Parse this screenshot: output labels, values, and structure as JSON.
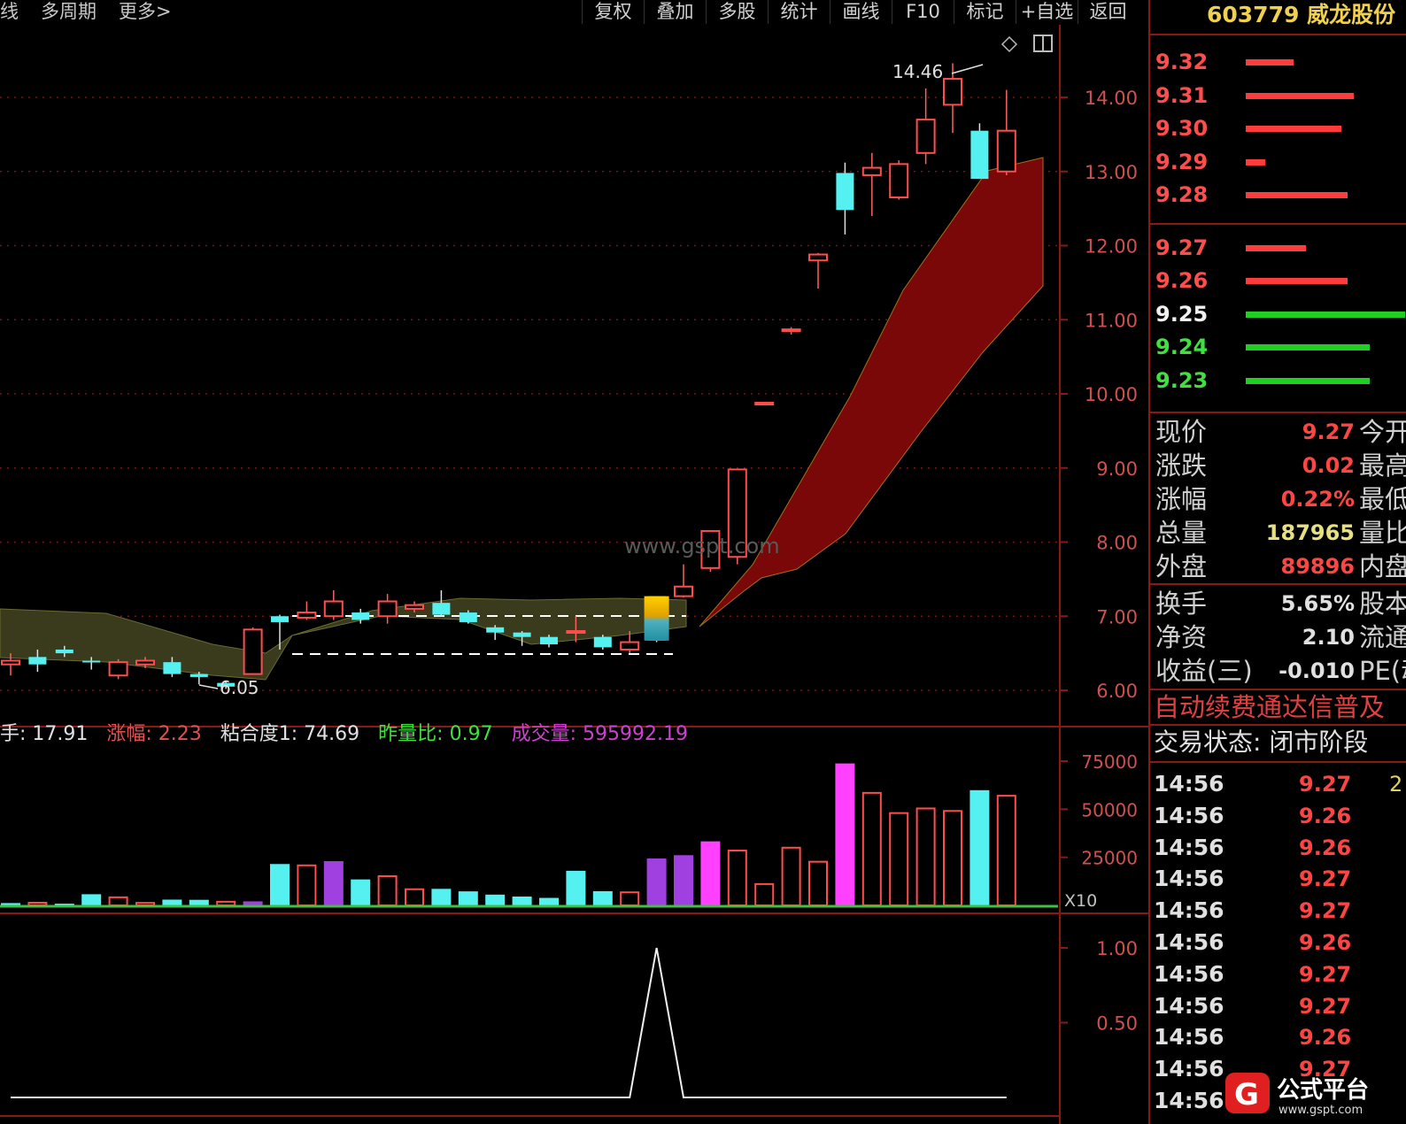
{
  "toolbar": {
    "left_items": [
      "线",
      "多周期",
      "更多>"
    ],
    "buttons": [
      "复权",
      "叠加",
      "多股",
      "统计",
      "画线",
      "F10",
      "标记",
      "+自选",
      "返回"
    ]
  },
  "stock": {
    "code": "603779",
    "name": "威龙股份"
  },
  "orderbook": [
    {
      "price": "9.32",
      "side": "ask",
      "size": 0.3
    },
    {
      "price": "9.31",
      "side": "ask",
      "size": 0.68
    },
    {
      "price": "9.30",
      "side": "ask",
      "size": 0.6
    },
    {
      "price": "9.29",
      "side": "ask",
      "size": 0.12
    },
    {
      "price": "9.28",
      "side": "ask",
      "size": 0.64
    },
    {
      "price": "9.27",
      "side": "bid",
      "size": 0.38
    },
    {
      "price": "9.26",
      "side": "bid",
      "size": 0.64
    },
    {
      "price": "9.25",
      "side": "bid",
      "size": 1.0
    },
    {
      "price": "9.24",
      "side": "bid",
      "size": 0.78
    },
    {
      "price": "9.23",
      "side": "bid",
      "size": 0.78
    }
  ],
  "quotes": [
    {
      "label": "现价",
      "value": "9.27",
      "label2": "今开",
      "color": "#ff4444"
    },
    {
      "label": "涨跌",
      "value": "0.02",
      "label2": "最高",
      "color": "#ff4444"
    },
    {
      "label": "涨幅",
      "value": "0.22%",
      "label2": "最低",
      "color": "#ff4444"
    },
    {
      "label": "总量",
      "value": "187965",
      "label2": "量比",
      "color": "#e8e080"
    },
    {
      "label": "外盘",
      "value": "89896",
      "label2": "内盘",
      "color": "#ff4444"
    },
    {
      "label": "换手",
      "value": "5.65%",
      "label2": "股本",
      "color": "#e0e0e0"
    },
    {
      "label": "净资",
      "value": "2.10",
      "label2": "流通",
      "color": "#e0e0e0"
    },
    {
      "label": "收益(三)",
      "value": "-0.010",
      "label2": "PE(动)",
      "color": "#e0e0e0"
    }
  ],
  "marquee": "自动续费通达信普及",
  "trade_status": "交易状态: 闭市阶段",
  "ticks": [
    {
      "time": "14:56",
      "price": "9.27",
      "extra": "2"
    },
    {
      "time": "14:56",
      "price": "9.26",
      "extra": ""
    },
    {
      "time": "14:56",
      "price": "9.26",
      "extra": ""
    },
    {
      "time": "14:56",
      "price": "9.27",
      "extra": ""
    },
    {
      "time": "14:56",
      "price": "9.27",
      "extra": ""
    },
    {
      "time": "14:56",
      "price": "9.26",
      "extra": ""
    },
    {
      "time": "14:56",
      "price": "9.27",
      "extra": ""
    },
    {
      "time": "14:56",
      "price": "9.27",
      "extra": ""
    },
    {
      "time": "14:56",
      "price": "9.26",
      "extra": ""
    },
    {
      "time": "14:56",
      "price": "9.27",
      "extra": ""
    },
    {
      "time": "14:56",
      "price": "",
      "extra": ""
    }
  ],
  "indicators": [
    {
      "text": "手: 17.91",
      "color": "#e0e0e0"
    },
    {
      "text": "涨幅: 2.23",
      "color": "#e05050"
    },
    {
      "text": "粘合度1: 74.69",
      "color": "#e0e0e0"
    },
    {
      "text": "昨量比: 0.97",
      "color": "#40e040"
    },
    {
      "text": "成交量: 595992.19",
      "color": "#d040d0"
    }
  ],
  "price_axis": [
    "14.00",
    "13.00",
    "12.00",
    "11.00",
    "10.00",
    "9.00",
    "8.00",
    "7.00",
    "6.00"
  ],
  "volume_axis": [
    "75000",
    "50000",
    "25000"
  ],
  "volume_unit": "X10",
  "osc_axis": [
    "1.00",
    "0.50"
  ],
  "annotations": {
    "high": "14.46",
    "low": "6.05"
  },
  "watermark": "www.gspt.com",
  "logo": {
    "name": "公式平台",
    "url": "www.gspt.com"
  },
  "chart_data": {
    "type": "candlestick",
    "candles": [
      {
        "o": 6.35,
        "c": 6.4,
        "h": 6.5,
        "l": 6.2
      },
      {
        "o": 6.45,
        "c": 6.35,
        "h": 6.55,
        "l": 6.25
      },
      {
        "o": 6.55,
        "c": 6.5,
        "h": 6.6,
        "l": 6.45
      },
      {
        "o": 6.4,
        "c": 6.38,
        "h": 6.45,
        "l": 6.28
      },
      {
        "o": 6.2,
        "c": 6.38,
        "h": 6.42,
        "l": 6.15
      },
      {
        "o": 6.35,
        "c": 6.4,
        "h": 6.45,
        "l": 6.3
      },
      {
        "o": 6.38,
        "c": 6.22,
        "h": 6.45,
        "l": 6.18
      },
      {
        "o": 6.22,
        "c": 6.18,
        "h": 6.25,
        "l": 6.08
      },
      {
        "o": 6.1,
        "c": 6.05,
        "h": 6.12,
        "l": 6.02
      },
      {
        "o": 6.22,
        "c": 6.82,
        "h": 6.85,
        "l": 6.22
      },
      {
        "o": 7.0,
        "c": 6.92,
        "h": 7.02,
        "l": 6.55
      },
      {
        "o": 6.98,
        "c": 7.05,
        "h": 7.2,
        "l": 6.95
      },
      {
        "o": 7.0,
        "c": 7.2,
        "h": 7.35,
        "l": 6.95
      },
      {
        "o": 7.05,
        "c": 6.95,
        "h": 7.1,
        "l": 6.9
      },
      {
        "o": 7.0,
        "c": 7.2,
        "h": 7.3,
        "l": 6.9
      },
      {
        "o": 7.1,
        "c": 7.15,
        "h": 7.2,
        "l": 7.05
      },
      {
        "o": 7.18,
        "c": 7.02,
        "h": 7.35,
        "l": 7.0
      },
      {
        "o": 7.05,
        "c": 6.92,
        "h": 7.08,
        "l": 6.9
      },
      {
        "o": 6.85,
        "c": 6.78,
        "h": 6.88,
        "l": 6.68
      },
      {
        "o": 6.78,
        "c": 6.72,
        "h": 6.8,
        "l": 6.6
      },
      {
        "o": 6.72,
        "c": 6.62,
        "h": 6.75,
        "l": 6.58
      },
      {
        "o": 6.8,
        "c": 6.8,
        "h": 7.0,
        "l": 6.65
      },
      {
        "o": 6.72,
        "c": 6.58,
        "h": 6.75,
        "l": 6.55
      },
      {
        "o": 6.55,
        "c": 6.65,
        "h": 6.8,
        "l": 6.5
      },
      {
        "o": 7.27,
        "c": 6.67,
        "h": 7.27,
        "l": 6.65
      },
      {
        "o": 7.27,
        "c": 7.4,
        "h": 7.7,
        "l": 7.25
      },
      {
        "o": 7.65,
        "c": 8.15,
        "h": 8.15,
        "l": 7.6
      },
      {
        "o": 7.8,
        "c": 8.98,
        "h": 8.98,
        "l": 7.7
      },
      {
        "o": 9.88,
        "c": 9.88,
        "h": 9.88,
        "l": 9.88
      },
      {
        "o": 10.87,
        "c": 10.87,
        "h": 10.9,
        "l": 10.8
      },
      {
        "o": 11.8,
        "c": 11.88,
        "h": 11.9,
        "l": 11.42
      },
      {
        "o": 12.98,
        "c": 12.48,
        "h": 13.12,
        "l": 12.15
      },
      {
        "o": 12.95,
        "c": 13.05,
        "h": 13.25,
        "l": 12.4
      },
      {
        "o": 12.65,
        "c": 13.1,
        "h": 13.15,
        "l": 12.62
      },
      {
        "o": 13.25,
        "c": 13.7,
        "h": 14.12,
        "l": 13.1
      },
      {
        "o": 13.9,
        "c": 14.25,
        "h": 14.46,
        "l": 13.52
      },
      {
        "o": 13.55,
        "c": 12.9,
        "h": 13.65,
        "l": 12.9
      },
      {
        "o": 13.0,
        "c": 13.55,
        "h": 14.1,
        "l": 12.95
      }
    ],
    "volumes": [
      1200,
      1400,
      900,
      5800,
      4200,
      1300,
      3000,
      2900,
      1900,
      2100,
      21500,
      20800,
      23000,
      13500,
      15200,
      8400,
      8600,
      7300,
      5600,
      4600,
      3900,
      18000,
      7400,
      6800,
      24400,
      26100,
      33300,
      28500,
      11100,
      30000,
      22700,
      73800,
      58500,
      48000,
      50400,
      49100,
      59900,
      57000
    ],
    "osc": [
      0,
      0,
      0,
      0,
      0,
      0,
      0,
      0,
      0,
      0,
      0,
      0,
      0,
      0,
      0,
      0,
      0,
      0,
      0,
      0,
      0,
      0,
      0,
      0,
      1,
      0,
      0,
      0,
      0,
      0,
      0,
      0,
      0,
      0,
      0,
      0,
      0,
      0
    ],
    "ylim": [
      5.8,
      14.9
    ]
  }
}
